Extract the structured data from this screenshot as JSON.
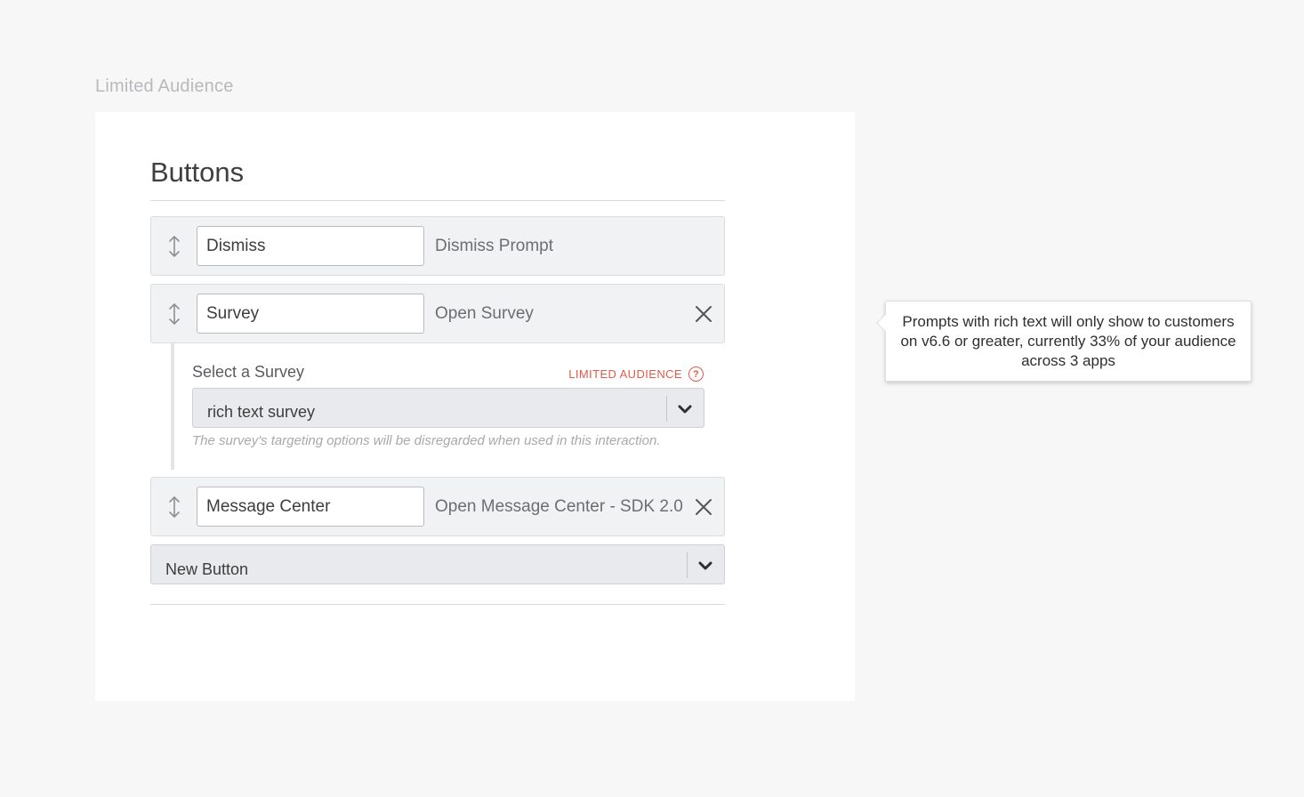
{
  "frame_label": "Limited Audience",
  "section": {
    "title": "Buttons"
  },
  "buttons": [
    {
      "label": "Dismiss",
      "action": "Dismiss Prompt",
      "removable": false
    },
    {
      "label": "Survey",
      "action": "Open Survey",
      "removable": true
    },
    {
      "label": "Message Center",
      "action": "Open Message Center - SDK 2.0",
      "removable": true
    }
  ],
  "survey_panel": {
    "label": "Select a Survey",
    "limited_audience_tag": "LIMITED AUDIENCE",
    "selected_value": "rich text survey",
    "help_text": "The survey's targeting options will be disregarded when used in this interaction."
  },
  "new_button": {
    "selected_value": "New Button"
  },
  "tooltip": {
    "text": "Prompts with rich text will only show to customers on v6.6 or greater, currently 33% of your audience across 3 apps"
  },
  "icons": {
    "drag": "drag-handle-icon",
    "remove": "close-icon",
    "caret": "chevron-down-icon",
    "help": "question-circle-icon"
  },
  "colors": {
    "accent_warning": "#e35a4a",
    "panel_bg": "#f1f2f4",
    "select_bg": "#e9eaed"
  }
}
